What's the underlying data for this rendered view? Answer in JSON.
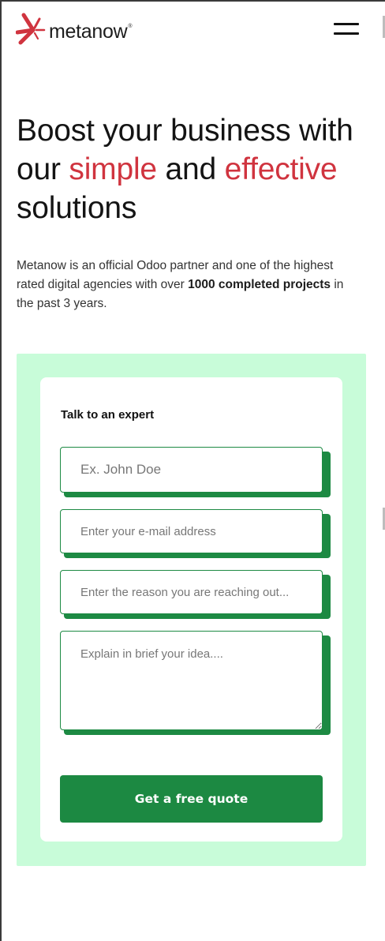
{
  "brand": {
    "name": "metanow",
    "registered_mark": "®",
    "accent_color": "#d0343f"
  },
  "header": {
    "menu_icon": "hamburger-menu-icon"
  },
  "hero": {
    "line1": "Boost your business with",
    "line2_prefix": "our ",
    "highlight1": "simple",
    "connector": " and ",
    "highlight2": "effective",
    "line3": "solutions"
  },
  "intro": {
    "text_before": "Metanow is an official Odoo partner and one of the highest rated digital agencies with over ",
    "bold": "1000 completed projects",
    "text_after": " in the past 3 years."
  },
  "form": {
    "background_color": "#c8fcd9",
    "field_color": "#1d8a43",
    "heading": "Talk to an expert",
    "name_placeholder": "Ex. John Doe",
    "email_placeholder": "Enter your e-mail address",
    "reason_placeholder": "Enter the reason you are reaching out...",
    "idea_placeholder": "Explain in brief your idea....",
    "submit_label": "Get a free quote"
  }
}
